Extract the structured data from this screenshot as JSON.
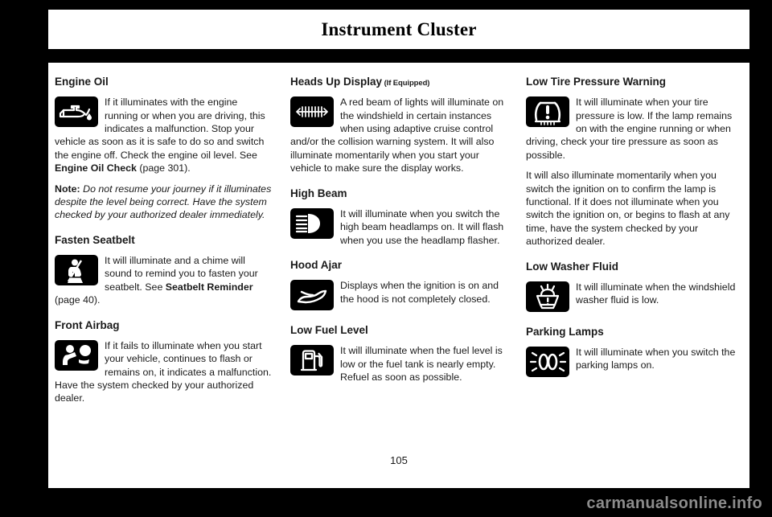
{
  "header": {
    "chapter_title": "Instrument Cluster"
  },
  "footer": {
    "page_number": "105",
    "watermark": "carmanualsonline.info"
  },
  "columns": [
    {
      "id": "column-1",
      "sections": [
        {
          "id": "engine-oil",
          "title": "Engine Oil",
          "icon": "engine-oil-icon",
          "paragraphs": [
            {
              "id": "engine-oil-body",
              "runs": [
                {
                  "text": "If it illuminates with the engine running or when you are driving, this indicates a malfunction. Stop your vehicle as soon as it is safe to do so and switch the engine off. Check the engine oil level.  See ",
                  "style": "normal"
                },
                {
                  "text": "Engine Oil Check",
                  "style": "bold"
                },
                {
                  "text": " (page 301).",
                  "style": "normal"
                }
              ]
            },
            {
              "id": "engine-oil-note",
              "runs": [
                {
                  "text": "Note:",
                  "style": "bold"
                },
                {
                  "text": " Do not resume your journey if it illuminates despite the level being correct. Have the system checked by your authorized dealer immediately.",
                  "style": "italic"
                }
              ]
            }
          ]
        },
        {
          "id": "fasten-seatbelt",
          "title": "Fasten Seatbelt",
          "icon": "seatbelt-icon",
          "paragraphs": [
            {
              "id": "fasten-seatbelt-body",
              "runs": [
                {
                  "text": "It will illuminate and a chime will sound to remind you to fasten your seatbelt.  See ",
                  "style": "normal"
                },
                {
                  "text": "Seatbelt Reminder",
                  "style": "bold"
                },
                {
                  "text": " (page 40).",
                  "style": "normal"
                }
              ]
            }
          ]
        },
        {
          "id": "front-airbag",
          "title": "Front Airbag",
          "icon": "airbag-icon",
          "paragraphs": [
            {
              "id": "front-airbag-body",
              "runs": [
                {
                  "text": "If it fails to illuminate when you start your vehicle, continues to flash or remains on, it indicates a malfunction. Have the system checked by your authorized dealer.",
                  "style": "normal"
                }
              ]
            }
          ]
        }
      ]
    },
    {
      "id": "column-2",
      "sections": [
        {
          "id": "heads-up-display",
          "title": "Heads Up Display",
          "title_suffix": "(If Equipped)",
          "icon": "heads-up-display-icon",
          "paragraphs": [
            {
              "id": "heads-up-display-body",
              "runs": [
                {
                  "text": "A red beam of lights will illuminate on the windshield in certain instances when using adaptive cruise control and/or the collision warning system. It will also illuminate momentarily when you start your vehicle to make sure the display works.",
                  "style": "normal"
                }
              ]
            }
          ]
        },
        {
          "id": "high-beam",
          "title": "High Beam",
          "icon": "high-beam-icon",
          "paragraphs": [
            {
              "id": "high-beam-body",
              "runs": [
                {
                  "text": "It will illuminate when you switch the high beam headlamps on. It will flash when you use the headlamp flasher.",
                  "style": "normal"
                }
              ]
            }
          ]
        },
        {
          "id": "hood-ajar",
          "title": "Hood Ajar",
          "icon": "hood-ajar-icon",
          "paragraphs": [
            {
              "id": "hood-ajar-body",
              "runs": [
                {
                  "text": "Displays when the ignition is on and the hood is not completely closed.",
                  "style": "normal"
                }
              ]
            }
          ]
        },
        {
          "id": "low-fuel-level",
          "title": "Low Fuel Level",
          "icon": "fuel-pump-icon",
          "paragraphs": [
            {
              "id": "low-fuel-level-body",
              "runs": [
                {
                  "text": "It will illuminate when the fuel level is low or the fuel tank is nearly empty. Refuel as soon as possible.",
                  "style": "normal"
                }
              ]
            }
          ]
        }
      ]
    },
    {
      "id": "column-3",
      "sections": [
        {
          "id": "low-tire-pressure-warning",
          "title": "Low Tire Pressure Warning",
          "icon": "tire-pressure-icon",
          "paragraphs": [
            {
              "id": "low-tire-pressure-body-1",
              "runs": [
                {
                  "text": "It will illuminate when your tire pressure is low. If the lamp remains on with the engine running or when driving, check your tire pressure as soon as possible.",
                  "style": "normal"
                }
              ]
            },
            {
              "id": "low-tire-pressure-body-2",
              "runs": [
                {
                  "text": "It will also illuminate momentarily when you switch the ignition on to confirm the lamp is functional. If it does not illuminate when you switch the ignition on, or begins to flash at any time, have the system checked by your authorized dealer.",
                  "style": "normal"
                }
              ]
            }
          ]
        },
        {
          "id": "low-washer-fluid",
          "title": "Low Washer Fluid",
          "icon": "washer-fluid-icon",
          "paragraphs": [
            {
              "id": "low-washer-fluid-body",
              "runs": [
                {
                  "text": "It will illuminate when the windshield washer fluid is low.",
                  "style": "normal"
                }
              ]
            }
          ]
        },
        {
          "id": "parking-lamps",
          "title": "Parking Lamps",
          "icon": "parking-lamps-icon",
          "paragraphs": [
            {
              "id": "parking-lamps-body",
              "runs": [
                {
                  "text": "It will illuminate when you switch the parking lamps on.",
                  "style": "normal"
                }
              ]
            }
          ]
        }
      ]
    }
  ]
}
